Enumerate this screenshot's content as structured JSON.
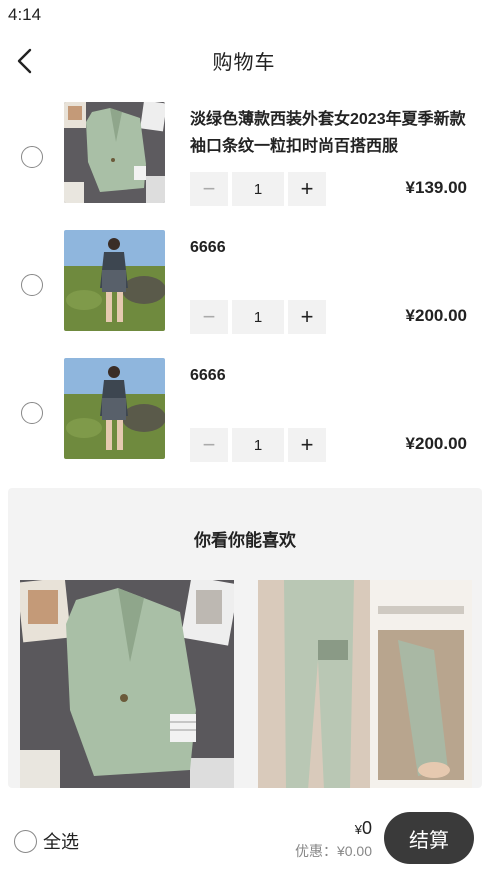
{
  "status_bar": {
    "time": "4:14"
  },
  "nav": {
    "title": "购物车",
    "back_icon": "chevron-left-icon"
  },
  "cart_items": [
    {
      "title": "淡绿色薄款西装外套女2023年夏季新款袖口条纹一粒扣时尚百搭西服",
      "quantity": "1",
      "price": "¥139.00",
      "thumbnail": "green-blazer-image",
      "selected": false
    },
    {
      "title": "6666",
      "quantity": "1",
      "price": "¥200.00",
      "thumbnail": "model-outfit-image",
      "selected": false
    },
    {
      "title": "6666",
      "quantity": "1",
      "price": "¥200.00",
      "thumbnail": "model-outfit-image",
      "selected": false
    }
  ],
  "stepper": {
    "minus": "−",
    "plus": "+"
  },
  "recommendations": {
    "title": "你看你能喜欢",
    "cards": [
      {
        "image": "green-blazer-image"
      },
      {
        "image": "sage-trousers-image"
      }
    ]
  },
  "bottom_bar": {
    "select_all_label": "全选",
    "yen": "¥",
    "total": "0",
    "discount": "优惠：¥0.00",
    "checkout_label": "结算"
  },
  "colors": {
    "checkout_bg": "#3a3a3a",
    "stepper_bg": "#f2f2f2",
    "reco_bg": "#f3f3f3",
    "blazer_green": "#a9bfa6"
  }
}
